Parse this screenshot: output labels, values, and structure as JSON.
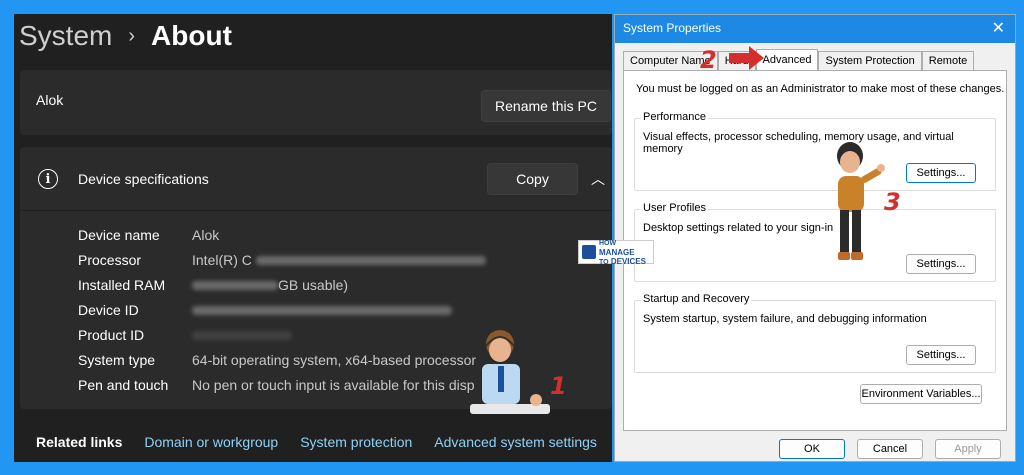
{
  "settings": {
    "breadcrumb": {
      "parent": "System",
      "separator": "›",
      "current": "About"
    },
    "pc_name": "Alok",
    "rename_button": "Rename this PC",
    "device_specs": {
      "title": "Device specifications",
      "copy_button": "Copy",
      "rows": [
        {
          "key": "Device name",
          "value": "Alok"
        },
        {
          "key": "Processor",
          "value": "Intel(R) C"
        },
        {
          "key": "Installed RAM",
          "value": "GB usable)"
        },
        {
          "key": "Device ID",
          "value": ""
        },
        {
          "key": "Product ID",
          "value": ""
        },
        {
          "key": "System type",
          "value": "64-bit operating system, x64-based processor"
        },
        {
          "key": "Pen and touch",
          "value": "No pen or touch input is available for this disp"
        }
      ]
    },
    "related_links": {
      "label": "Related links",
      "links": [
        "Domain or workgroup",
        "System protection",
        "Advanced system settings"
      ]
    }
  },
  "dialog": {
    "title": "System Properties",
    "close_glyph": "✕",
    "tabs": [
      "Computer Name",
      "Hard",
      "Advanced",
      "System Protection",
      "Remote"
    ],
    "active_tab": "Advanced",
    "notice": "You must be logged on as an Administrator to make most of these changes.",
    "groups": [
      {
        "title": "Performance",
        "description": "Visual effects, processor scheduling, memory usage, and virtual memory",
        "button": "Settings..."
      },
      {
        "title": "User Profiles",
        "description": "Desktop settings related to your sign-in",
        "button": "Settings..."
      },
      {
        "title": "Startup and Recovery",
        "description": "System startup, system failure, and debugging information",
        "button": "Settings..."
      }
    ],
    "env_button": "Environment Variables...",
    "ok": "OK",
    "cancel": "Cancel",
    "apply": "Apply"
  },
  "overlay": {
    "steps": [
      "1",
      "2",
      "3"
    ],
    "logo": {
      "line1": "HOW",
      "line2": "TO",
      "brand1": "MANAGE",
      "brand2": "DEVICES"
    }
  },
  "colors": {
    "frame": "#2196f3",
    "settings_bg": "#202020",
    "card_bg": "#2b2b2b",
    "link": "#8fd1f5",
    "titlebar": "#1e88e5",
    "step_red": "#d32f2f"
  }
}
